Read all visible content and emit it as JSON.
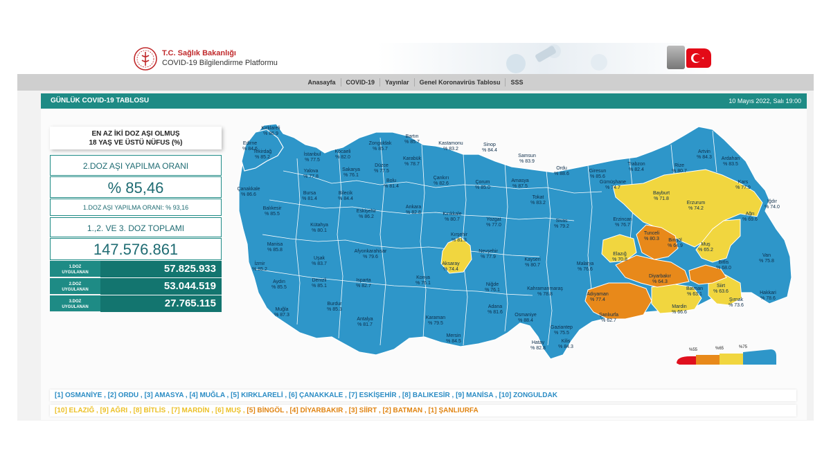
{
  "header": {
    "brand_line1": "T.C. Sağlık Bakanlığı",
    "brand_line2": "COVID-19 Bilgilendirme Platformu",
    "logo_icon": "ministry-of-health-logo-icon",
    "flag_icon": "turkish-flag-icon"
  },
  "nav": {
    "items": [
      "Anasayfa",
      "COVID-19",
      "Yayınlar",
      "Genel Koronavirüs Tablosu",
      "SSS"
    ]
  },
  "panel": {
    "title": "GÜNLÜK COVID-19 TABLOSU",
    "datetime": "10 Mayıs 2022, Salı 19:00"
  },
  "vaccination": {
    "heading_line1": "EN AZ İKİ DOZ AŞI OLMUŞ",
    "heading_line2": "18 YAŞ VE ÜSTÜ NÜFUS (%)",
    "dose2_rate_label": "2.DOZ AŞI YAPILMA ORANI",
    "dose2_rate_value": "% 85,46",
    "dose1_rate_text": "1.DOZ AŞI YAPILMA ORANI: % 93,16",
    "total_label": "1.,2. VE 3. DOZ TOPLAMI",
    "total_value": "147.576.861",
    "doses": [
      {
        "label_line1": "1.DOZ",
        "label_line2": "UYGULANAN",
        "value": "57.825.933"
      },
      {
        "label_line1": "2.DOZ",
        "label_line2": "UYGULANAN",
        "value": "53.044.519"
      },
      {
        "label_line1": "3.DOZ",
        "label_line2": "UYGULANAN",
        "value": "27.765.115"
      }
    ]
  },
  "colors": {
    "teal": "#1e8b85",
    "blue_above_75": "#2e96c9",
    "yellow_65_75": "#f1d63f",
    "orange_55_65": "#e8891a",
    "red_below_55": "#e0101e"
  },
  "legend": {
    "ticks": [
      "%55",
      "%65",
      "%75"
    ]
  },
  "map_labels": [
    {
      "name": "Kırklareli",
      "value": "% 86.9"
    },
    {
      "name": "Edirne",
      "value": "% 84.6"
    },
    {
      "name": "Tekirdağ",
      "value": "% 85.2"
    },
    {
      "name": "İstanbul",
      "value": "% 77.5"
    },
    {
      "name": "Kocaeli",
      "value": "% 82.0"
    },
    {
      "name": "Yalova",
      "value": "% 77.8"
    },
    {
      "name": "Zonguldak",
      "value": "% 85.7"
    },
    {
      "name": "Bartın",
      "value": "% 85.7"
    },
    {
      "name": "Kastamonu",
      "value": "% 83.2"
    },
    {
      "name": "Sinop",
      "value": "% 84.4"
    },
    {
      "name": "Samsun",
      "value": "% 83.9"
    },
    {
      "name": "Karabük",
      "value": "% 78.7"
    },
    {
      "name": "Düzce",
      "value": "% 77.5"
    },
    {
      "name": "Sakarya",
      "value": "% 76.1"
    },
    {
      "name": "Bolu",
      "value": "% 81.4"
    },
    {
      "name": "Çankırı",
      "value": "% 82.6"
    },
    {
      "name": "Çorum",
      "value": "% 85.0"
    },
    {
      "name": "Amasya",
      "value": "% 87.5"
    },
    {
      "name": "Ordu",
      "value": "% 88.6"
    },
    {
      "name": "Giresun",
      "value": "% 85.6"
    },
    {
      "name": "Trabzon",
      "value": "% 82.4"
    },
    {
      "name": "Rize",
      "value": "% 80.7"
    },
    {
      "name": "Artvin",
      "value": "% 84.3"
    },
    {
      "name": "Ardahan",
      "value": "% 83.5"
    },
    {
      "name": "Çanakkale",
      "value": "% 86.6"
    },
    {
      "name": "Bursa",
      "value": "% 81.4"
    },
    {
      "name": "Bilecik",
      "value": "% 84.4"
    },
    {
      "name": "Balıkesir",
      "value": "% 85.5"
    },
    {
      "name": "Eskişehir",
      "value": "% 86.2"
    },
    {
      "name": "Ankara",
      "value": "% 82.8"
    },
    {
      "name": "Kırıkkale",
      "value": "% 80.7"
    },
    {
      "name": "Yozgat",
      "value": "% 77.0"
    },
    {
      "name": "Tokat",
      "value": "% 83.2"
    },
    {
      "name": "Sivas",
      "value": "% 79.2"
    },
    {
      "name": "Gümüşhane",
      "value": "% 74.7"
    },
    {
      "name": "Bayburt",
      "value": "% 71.8"
    },
    {
      "name": "Erzurum",
      "value": "% 74.2"
    },
    {
      "name": "Kars",
      "value": "% 77.9"
    },
    {
      "name": "Iğdır",
      "value": "% 74.0"
    },
    {
      "name": "Ağrı",
      "value": "% 69.6"
    },
    {
      "name": "Erzincan",
      "value": "% 76.7"
    },
    {
      "name": "Tunceli",
      "value": "% 80.3"
    },
    {
      "name": "Bingöl",
      "value": "% 64.9"
    },
    {
      "name": "Muş",
      "value": "% 65.2"
    },
    {
      "name": "Kütahya",
      "value": "% 80.1"
    },
    {
      "name": "Manisa",
      "value": "% 85.8"
    },
    {
      "name": "İzmir",
      "value": "% 85.2"
    },
    {
      "name": "Uşak",
      "value": "% 83.7"
    },
    {
      "name": "Afyonkarahisar",
      "value": "% 79.6"
    },
    {
      "name": "Kırşehir",
      "value": "% 81.3"
    },
    {
      "name": "Nevşehir",
      "value": "% 77.9"
    },
    {
      "name": "Aksaray",
      "value": "% 74.4"
    },
    {
      "name": "Kayseri",
      "value": "% 80.7"
    },
    {
      "name": "Malatya",
      "value": "% 76.6"
    },
    {
      "name": "Elazığ",
      "value": "% 70.8"
    },
    {
      "name": "Bitlis",
      "value": "% 68.0"
    },
    {
      "name": "Van",
      "value": "% 75.8"
    },
    {
      "name": "Aydın",
      "value": "% 85.5"
    },
    {
      "name": "Denizli",
      "value": "% 85.1"
    },
    {
      "name": "Isparta",
      "value": "% 82.7"
    },
    {
      "name": "Konya",
      "value": "% 76.1"
    },
    {
      "name": "Niğde",
      "value": "% 76.1"
    },
    {
      "name": "Kahramanmaraş",
      "value": "% 78.8"
    },
    {
      "name": "Adıyaman",
      "value": "% 77.4"
    },
    {
      "name": "Diyarbakır",
      "value": "% 64.3"
    },
    {
      "name": "Batman",
      "value": "% 63.1"
    },
    {
      "name": "Siirt",
      "value": "% 63.6"
    },
    {
      "name": "Hakkari",
      "value": "% 78.6"
    },
    {
      "name": "Şırnak",
      "value": "% 73.6"
    },
    {
      "name": "Muğla",
      "value": "% 87.3"
    },
    {
      "name": "Burdur",
      "value": "% 85.3"
    },
    {
      "name": "Antalya",
      "value": "% 81.7"
    },
    {
      "name": "Karaman",
      "value": "% 79.5"
    },
    {
      "name": "Mersin",
      "value": "% 84.5"
    },
    {
      "name": "Adana",
      "value": "% 81.6"
    },
    {
      "name": "Osmaniye",
      "value": "% 88.4"
    },
    {
      "name": "Gaziantep",
      "value": "% 75.5"
    },
    {
      "name": "Kilis",
      "value": "% 84.3"
    },
    {
      "name": "Hatay",
      "value": "% 82.8"
    },
    {
      "name": "Şanlıurfa",
      "value": "% 62.7"
    },
    {
      "name": "Mardin",
      "value": "% 66.6"
    }
  ],
  "rankings": {
    "top": "[1] OSMANİYE , [2] ORDU , [3] AMASYA , [4] MUĞLA , [5] KIRKLARELİ , [6] ÇANAKKALE , [7] ESKİŞEHİR , [8] BALIKESİR , [9] MANİSA , [10] ZONGULDAK",
    "bottom_yellow": "[10] ELAZIĞ , [9] AĞRI , [8] BİTLİS , [7] MARDİN , [6] MUŞ ,",
    "bottom_orange": "[5] BİNGÖL , [4] DİYARBAKIR , [3] SİİRT , [2] BATMAN , [1] ŞANLIURFA"
  }
}
